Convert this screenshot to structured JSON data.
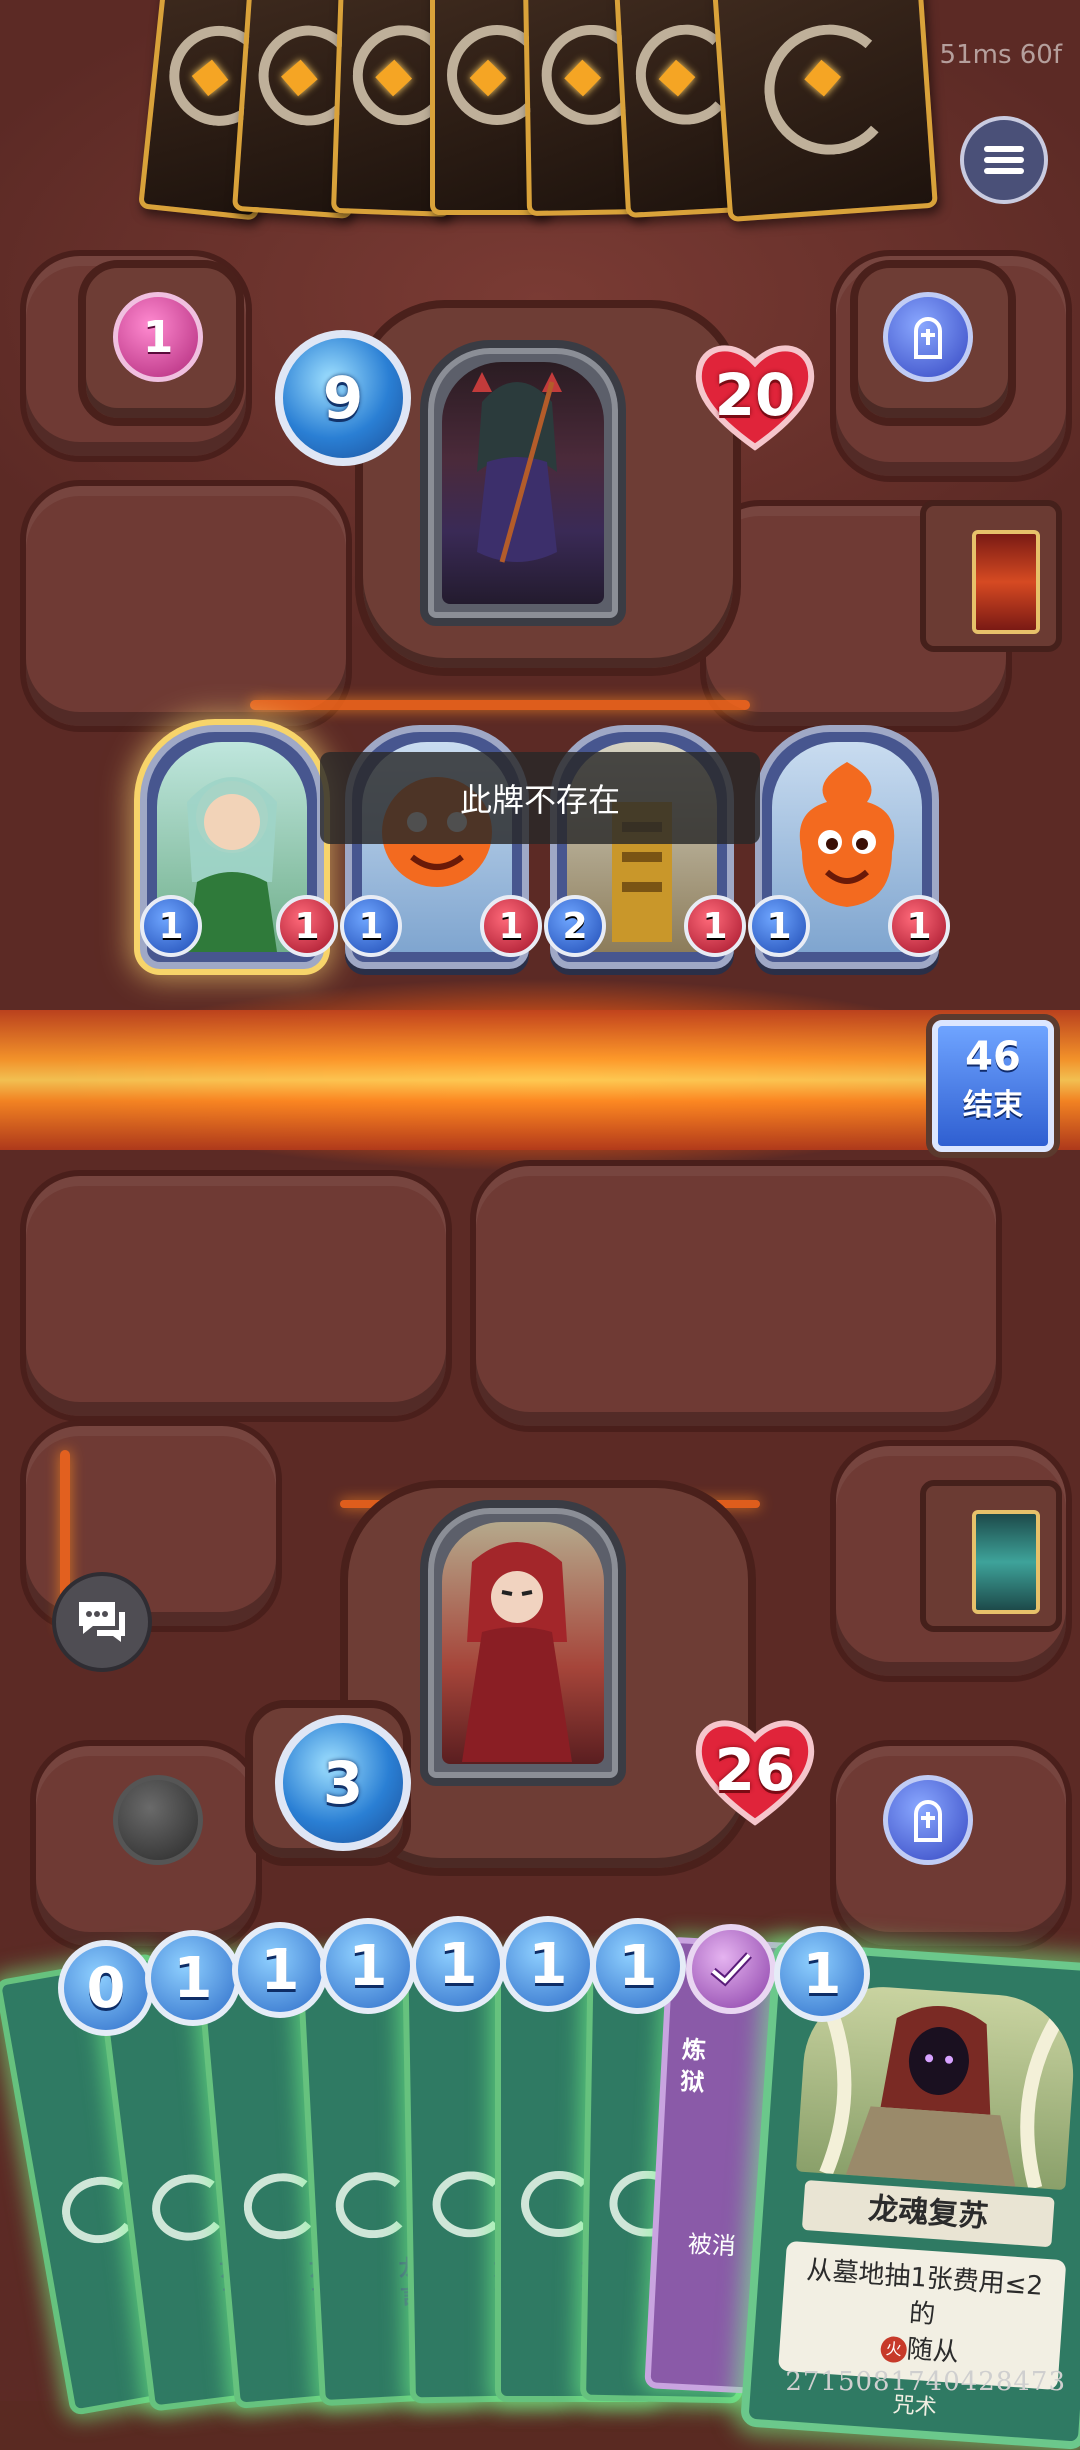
{
  "perf": {
    "text": "51ms 60f"
  },
  "opponent": {
    "mana": "9",
    "health": "20",
    "pink_counter": "1"
  },
  "board": {
    "minions": [
      {
        "name": "elf-druid",
        "attack": "1",
        "health": "1"
      },
      {
        "name": "fire-imp-1",
        "attack": "1",
        "health": "1"
      },
      {
        "name": "golden-warrior",
        "attack": "2",
        "health": "1"
      },
      {
        "name": "fire-imp-2",
        "attack": "1",
        "health": "1"
      }
    ]
  },
  "toast": {
    "text": "此牌不存在"
  },
  "end_turn": {
    "timer": "46",
    "label": "结束"
  },
  "player": {
    "mana": "3",
    "health": "26"
  },
  "hand": {
    "costs": [
      "0",
      "1",
      "1",
      "1",
      "1",
      "1",
      "1"
    ],
    "small_text": [
      {
        "line1": "龙",
        "line2": "言:"
      },
      {
        "line1": "龙",
        "line2": "言:"
      },
      {
        "line1": "龙",
        "line2": "言:"
      },
      {
        "line1": "龙",
        "line2": "言:"
      },
      {
        "line1": "龙",
        "line2": "言:"
      },
      {
        "line1": "龙",
        "line2": "言:"
      }
    ],
    "purple_card": {
      "title": "炼狱",
      "body": "被消"
    },
    "featured": {
      "cost": "1",
      "name": "龙魂复苏",
      "desc_line1": "从墓地抽1张费用≤2的",
      "desc_line2": "随从",
      "type": "咒术",
      "element": "火"
    }
  },
  "footer_code": "2715081740428473"
}
